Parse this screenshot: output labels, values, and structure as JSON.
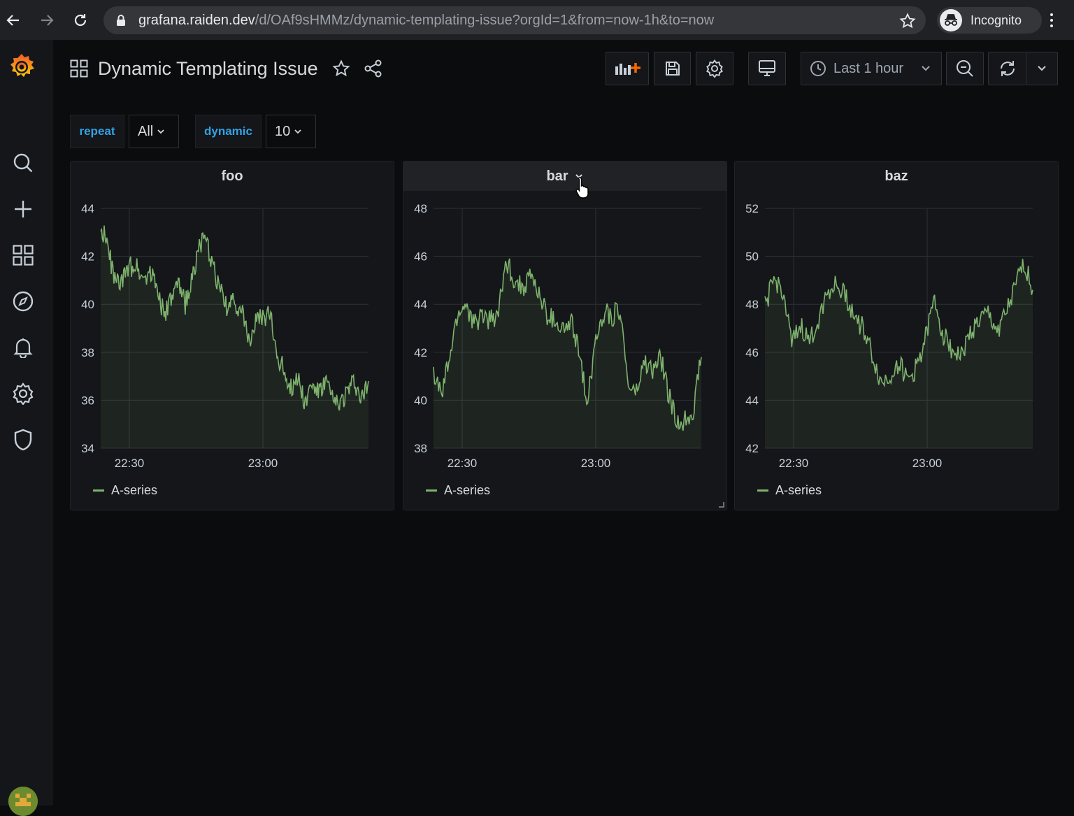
{
  "browser": {
    "url_host": "grafana.raiden.dev",
    "url_path": "/d/OAf9sHMMz/dynamic-templating-issue?orgId=1&from=now-1h&to=now",
    "incognito_label": "Incognito"
  },
  "dashboard": {
    "title": "Dynamic Templating Issue",
    "time_range": "Last 1 hour"
  },
  "variables": [
    {
      "name": "repeat",
      "value": "All"
    },
    {
      "name": "dynamic",
      "value": "10"
    }
  ],
  "colors": {
    "series": "#7eb26d",
    "accent": "#33a2e5",
    "grafana_orange": "#f46800"
  },
  "chart_data": [
    {
      "type": "area",
      "title": "foo",
      "x_ticks": [
        "22:30",
        "23:00"
      ],
      "ylim": [
        34,
        44
      ],
      "y_ticks": [
        "34",
        "36",
        "38",
        "40",
        "42",
        "44"
      ],
      "grid": true,
      "legend": "bottom-left",
      "series": [
        {
          "name": "A-series",
          "values": [
            43.3,
            42.4,
            41.0,
            40.9,
            41.5,
            41.7,
            41.1,
            41.4,
            40.8,
            39.5,
            40.2,
            40.8,
            40.0,
            41.1,
            42.5,
            42.6,
            41.5,
            40.5,
            39.8,
            40.1,
            39.7,
            38.5,
            39.3,
            39.4,
            39.6,
            37.9,
            37.3,
            36.5,
            37.0,
            35.9,
            36.7,
            36.3,
            36.8,
            35.9,
            35.9,
            36.4,
            36.8,
            36.0,
            36.8
          ]
        }
      ]
    },
    {
      "type": "area",
      "title": "bar",
      "x_ticks": [
        "22:30",
        "23:00"
      ],
      "ylim": [
        38,
        48
      ],
      "y_ticks": [
        "38",
        "40",
        "42",
        "44",
        "46",
        "48"
      ],
      "grid": true,
      "legend": "bottom-left",
      "series": [
        {
          "name": "A-series",
          "values": [
            41.1,
            40.2,
            41.8,
            43.6,
            44.0,
            43.1,
            43.6,
            43.3,
            43.7,
            45.8,
            45.0,
            44.7,
            45.2,
            44.4,
            43.5,
            43.3,
            42.9,
            43.2,
            41.9,
            39.9,
            42.7,
            43.7,
            43.5,
            43.8,
            40.6,
            40.3,
            41.6,
            41.2,
            41.8,
            40.2,
            39.0,
            39.2,
            39.6,
            41.8
          ]
        }
      ]
    },
    {
      "type": "area",
      "title": "baz",
      "x_ticks": [
        "22:30",
        "23:00"
      ],
      "ylim": [
        42,
        52
      ],
      "y_ticks": [
        "42",
        "44",
        "46",
        "48",
        "50",
        "52"
      ],
      "grid": true,
      "legend": "bottom-left",
      "series": [
        {
          "name": "A-series",
          "values": [
            47.9,
            49.0,
            48.6,
            46.3,
            47.1,
            46.4,
            47.4,
            48.6,
            48.8,
            48.4,
            47.5,
            47.0,
            45.9,
            44.7,
            45.0,
            45.6,
            44.8,
            45.4,
            46.6,
            48.2,
            46.7,
            46.1,
            45.8,
            46.8,
            47.3,
            47.6,
            46.9,
            47.6,
            48.6,
            49.8,
            48.6
          ]
        }
      ]
    }
  ]
}
